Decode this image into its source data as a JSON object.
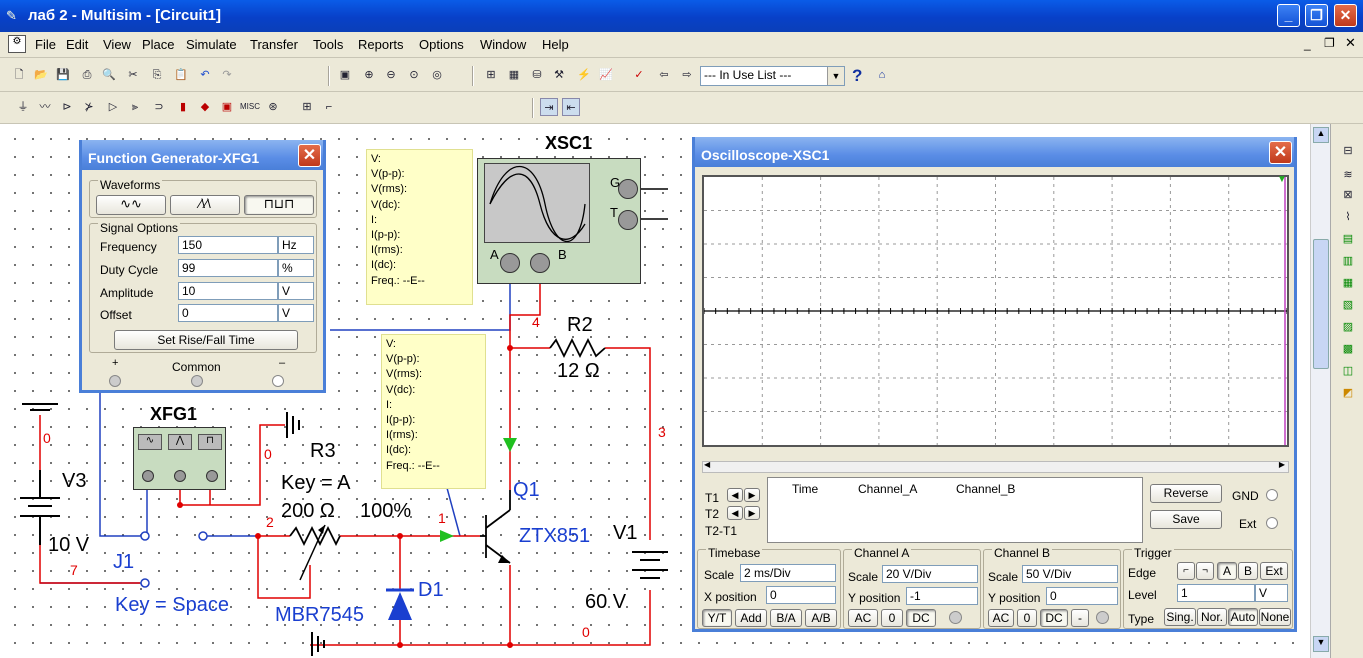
{
  "window": {
    "title": "лаб 2 - Multisim - [Circuit1]"
  },
  "menu": [
    "File",
    "Edit",
    "View",
    "Place",
    "Simulate",
    "Transfer",
    "Tools",
    "Reports",
    "Options",
    "Window",
    "Help"
  ],
  "toolbar": {
    "in_use_list": "--- In Use List ---",
    "help": "?"
  },
  "function_generator": {
    "title": "Function Generator-XFG1",
    "waveforms_label": "Waveforms",
    "signal_options_label": "Signal Options",
    "rows": [
      {
        "label": "Frequency",
        "value": "150",
        "unit": "Hz"
      },
      {
        "label": "Duty Cycle",
        "value": "99",
        "unit": "%"
      },
      {
        "label": "Amplitude",
        "value": "10",
        "unit": "V"
      },
      {
        "label": "Offset",
        "value": "0",
        "unit": "V"
      }
    ],
    "set_rise_fall": "Set Rise/Fall Time",
    "plus": "+",
    "common": "Common",
    "minus": "–",
    "selected_waveform": "square"
  },
  "probe1": {
    "lines": [
      "V:",
      "V(p-p):",
      "V(rms):",
      "V(dc):",
      "I:",
      "I(p-p):",
      "I(rms):",
      "I(dc):",
      "Freq.: --E--"
    ]
  },
  "probe2": {
    "lines": [
      "V:",
      "V(p-p):",
      "V(rms):",
      "V(dc):",
      "I:",
      "I(p-p):",
      "I(rms):",
      "I(dc):",
      "Freq.: --E--"
    ]
  },
  "schematic": {
    "xsc1": "XSC1",
    "xsc_g": "G",
    "xsc_t": "T",
    "xsc_a": "A",
    "xsc_b": "B",
    "xfg1": "XFG1",
    "r2": "R2",
    "r2_value": "12 Ω",
    "r3": "R3",
    "r3_key": "Key = A",
    "r3_value": "200 Ω",
    "r3_pct": "100%",
    "q1": "Q1",
    "q1_model": "ZTX851",
    "v1": "V1",
    "v1_value": "60 V",
    "v3": "V3",
    "v3_value": "10 V",
    "j1": "J1",
    "j1_key": "Key = Space",
    "d1": "D1",
    "d1_model": "MBR7545",
    "net_0a": "0",
    "net_0b": "0",
    "net_0c": "0",
    "net_1": "1",
    "net_2": "2",
    "net_3": "3",
    "net_4": "4",
    "net_7": "7"
  },
  "oscilloscope": {
    "title": "Oscilloscope-XSC1",
    "t1": "T1",
    "t2": "T2",
    "t2t1": "T2-T1",
    "col_time": "Time",
    "col_a": "Channel_A",
    "col_b": "Channel_B",
    "reverse": "Reverse",
    "save": "Save",
    "gnd": "GND",
    "ext": "Ext",
    "timebase": {
      "label": "Timebase",
      "scale_label": "Scale",
      "scale": "2 ms/Div",
      "xpos_label": "X position",
      "xpos": "0",
      "buttons": [
        "Y/T",
        "Add",
        "B/A",
        "A/B"
      ]
    },
    "channel_a": {
      "label": "Channel A",
      "scale_label": "Scale",
      "scale": "20  V/Div",
      "ypos_label": "Y position",
      "ypos": "-1",
      "buttons": [
        "AC",
        "0",
        "DC"
      ]
    },
    "channel_b": {
      "label": "Channel B",
      "scale_label": "Scale",
      "scale": "50  V/Div",
      "ypos_label": "Y position",
      "ypos": "0",
      "buttons": [
        "AC",
        "0",
        "DC",
        "-"
      ]
    },
    "trigger": {
      "label": "Trigger",
      "edge_label": "Edge",
      "edge_buttons": [
        "A",
        "B",
        "Ext"
      ],
      "level_label": "Level",
      "level": "1",
      "level_unit": "V",
      "type_label": "Type",
      "type_buttons": [
        "Sing.",
        "Nor.",
        "Auto",
        "None"
      ]
    }
  },
  "colors": {
    "wire_red": "#e00000",
    "wire_blue": "#2040c0",
    "label_blue": "#1a3fd0",
    "probe_bg": "#ffffc8",
    "scope_bg": "#ffffff"
  }
}
